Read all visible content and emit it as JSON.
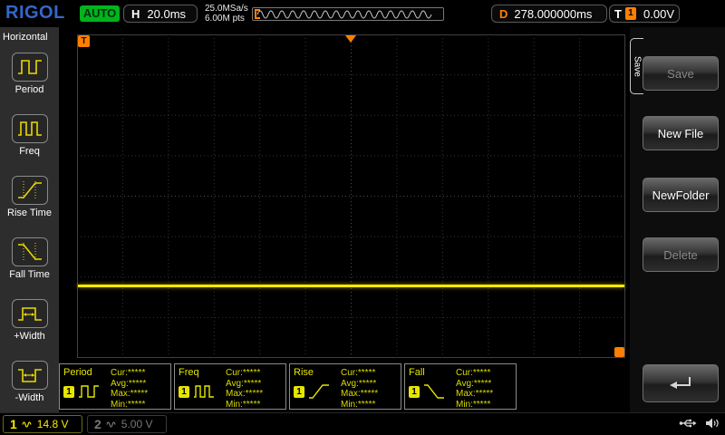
{
  "colors": {
    "channel1_yellow": "#f6ea00",
    "accent_orange": "#ff8000",
    "auto_green": "#00b41e",
    "logo_blue": "#3566c9",
    "inactive_gray": "#787878"
  },
  "top_bar": {
    "logo": "RIGOL",
    "mode": "AUTO",
    "horizontal_label": "H",
    "timebase": "20.0ms",
    "sample_rate": "25.0MSa/s",
    "memory_depth": "6.00M pts",
    "delay_label": "D",
    "delay_value": "278.000000ms",
    "trigger_label": "T",
    "trigger_channel": "1",
    "trigger_level": "0.00V"
  },
  "sidebar": {
    "title": "Horizontal",
    "items": [
      {
        "label": "Period",
        "icon": "period-icon"
      },
      {
        "label": "Freq",
        "icon": "freq-icon"
      },
      {
        "label": "Rise Time",
        "icon": "rise-time-icon"
      },
      {
        "label": "Fall Time",
        "icon": "fall-time-icon"
      },
      {
        "label": "+Width",
        "icon": "plus-width-icon"
      },
      {
        "label": "-Width",
        "icon": "minus-width-icon"
      }
    ]
  },
  "grid": {
    "trigger_corner_label": "T"
  },
  "measurements": [
    {
      "name": "Period",
      "channel": "1",
      "cur": "Cur:*****",
      "avg": "Avg:*****",
      "max": "Max:*****",
      "min": "Min:*****"
    },
    {
      "name": "Freq",
      "channel": "1",
      "cur": "Cur:*****",
      "avg": "Avg:*****",
      "max": "Max:*****",
      "min": "Min:*****"
    },
    {
      "name": "Rise",
      "channel": "1",
      "cur": "Cur:*****",
      "avg": "Avg:*****",
      "max": "Max:*****",
      "min": "Min:*****"
    },
    {
      "name": "Fall",
      "channel": "1",
      "cur": "Cur:*****",
      "avg": "Avg:*****",
      "max": "Max:*****",
      "min": "Min:*****"
    }
  ],
  "menu": {
    "tab": "Save",
    "buttons": [
      {
        "label": "Save",
        "enabled": false
      },
      {
        "label": "New File",
        "enabled": true
      },
      {
        "label": "NewFolder",
        "enabled": true
      },
      {
        "label": "Delete",
        "enabled": false
      }
    ],
    "back_button_icon": "return-icon"
  },
  "status_bar": {
    "channels": [
      {
        "number": "1",
        "scale": "14.8 V",
        "active": true
      },
      {
        "number": "2",
        "scale": "5.00 V",
        "active": false
      }
    ],
    "icons": [
      "usb-icon",
      "speaker-icon"
    ]
  }
}
